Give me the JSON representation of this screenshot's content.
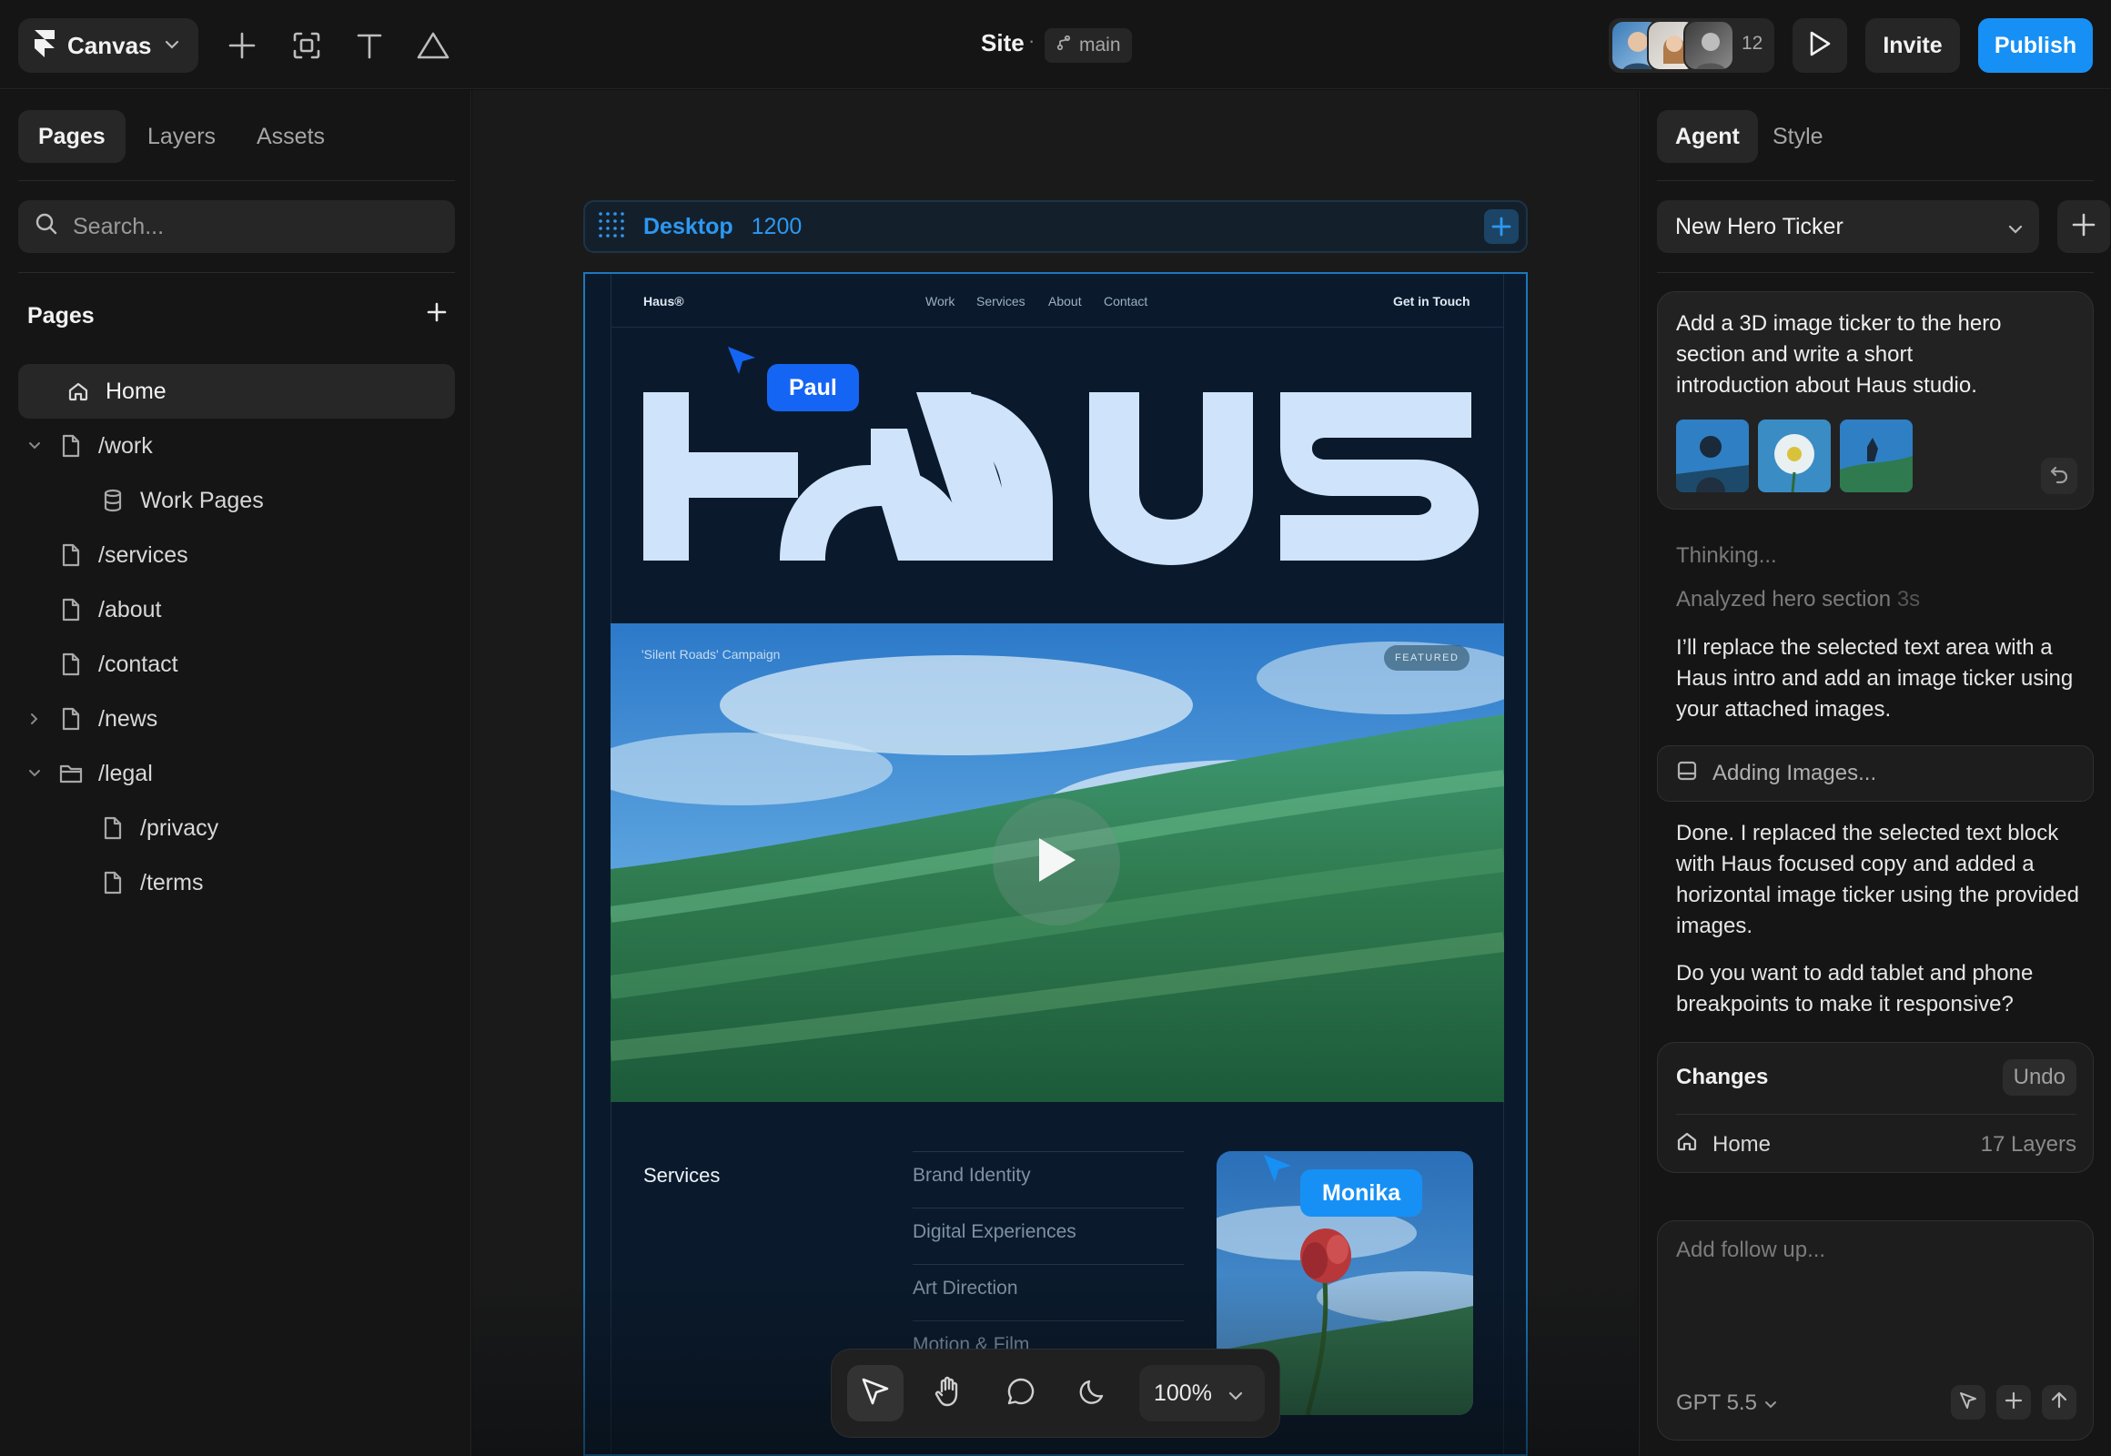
{
  "topbar": {
    "app_menu_label": "Canvas",
    "site_title": "Site",
    "separator": "·",
    "branch": "main",
    "collaborator_count": "12",
    "invite_label": "Invite",
    "publish_label": "Publish",
    "publish_color": "#1790f5"
  },
  "left_panel": {
    "tabs": [
      {
        "label": "Pages",
        "active": true
      },
      {
        "label": "Layers",
        "active": false
      },
      {
        "label": "Assets",
        "active": false
      }
    ],
    "search_placeholder": "Search...",
    "pages_heading": "Pages",
    "pages": [
      {
        "label": "Home",
        "icon": "home-icon",
        "active": true
      },
      {
        "label": "/work",
        "icon": "file-icon",
        "expanded": true
      },
      {
        "label": "Work Pages",
        "icon": "database-icon"
      },
      {
        "label": "/services",
        "icon": "file-icon"
      },
      {
        "label": "/about",
        "icon": "file-icon"
      },
      {
        "label": "/contact",
        "icon": "file-icon"
      },
      {
        "label": "/news",
        "icon": "file-icon",
        "expanded": false
      },
      {
        "label": "/legal",
        "icon": "folder-icon",
        "expanded": true
      },
      {
        "label": "/privacy",
        "icon": "file-icon"
      },
      {
        "label": "/terms",
        "icon": "file-icon"
      }
    ]
  },
  "canvas": {
    "frame_name": "Desktop",
    "frame_width": "1200",
    "accent_color": "#2d98f2",
    "site": {
      "logo": "Haus®",
      "nav": [
        "Work",
        "Services",
        "About",
        "Contact"
      ],
      "cta": "Get in Touch",
      "hero_title": "HAUS",
      "hero_caption": "'Silent Roads' Campaign",
      "hero_badge": "FEATURED",
      "services_label": "Services",
      "services": [
        "Brand Identity",
        "Digital Experiences",
        "Art Direction",
        "Motion & Film"
      ]
    },
    "cursors": [
      {
        "name": "Paul",
        "color": "#1565f5"
      },
      {
        "name": "Monika",
        "color": "#1790f5"
      }
    ],
    "zoom": "100%"
  },
  "right_panel": {
    "tabs": [
      {
        "label": "Agent",
        "active": true
      },
      {
        "label": "Style",
        "active": false
      }
    ],
    "thread_name": "New Hero Ticker",
    "user_message": "Add a 3D image ticker to the hero section and write a short introduction about Haus studio.",
    "thinking": "Thinking...",
    "analyzed": "Analyzed hero section",
    "analyzed_time": "3s",
    "agent_reply_1": "I’ll replace the selected text area with a Haus intro and add an image ticker using your attached images.",
    "adding_status": "Adding Images...",
    "agent_reply_2": "Done. I replaced the selected text block with Haus focused copy and added a horizontal image ticker using the provided images.",
    "agent_reply_3": "Do you want to add tablet and phone breakpoints to make it responsive?",
    "changes": {
      "title": "Changes",
      "undo_label": "Undo",
      "page": "Home",
      "layers": "17 Layers"
    },
    "composer": {
      "placeholder": "Add follow up...",
      "model": "GPT 5.5"
    }
  }
}
